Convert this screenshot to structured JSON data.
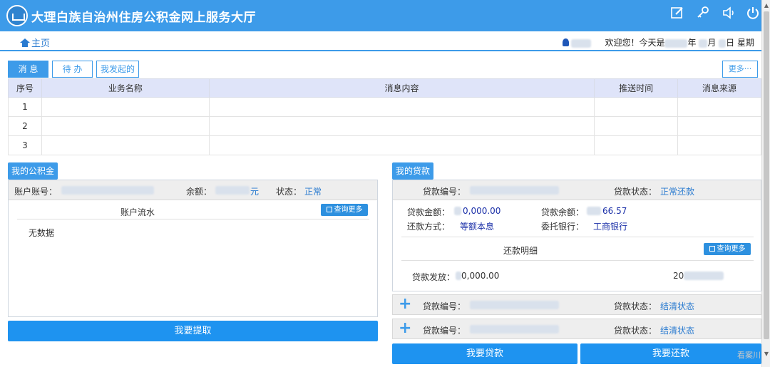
{
  "header": {
    "title": "大理白族自治州住房公积金网上服务大厅",
    "icons": [
      "edit-icon",
      "key-icon",
      "speaker-icon",
      "power-icon"
    ]
  },
  "nav": {
    "home": "主页",
    "welcome": "欢迎您！今天是",
    "date_year_suffix": "年",
    "date_month_suffix": "月",
    "date_day_suffix": "日 星期"
  },
  "tabs": [
    {
      "label": "消 息",
      "active": true
    },
    {
      "label": "待 办",
      "active": false
    },
    {
      "label": "我发起的",
      "active": false
    }
  ],
  "more_label": "更多···",
  "messages": {
    "columns": [
      "序号",
      "业务名称",
      "消息内容",
      "推送时间",
      "消息来源"
    ],
    "rows": [
      {
        "index": "1",
        "business": "",
        "content": "",
        "time": "",
        "source": ""
      },
      {
        "index": "2",
        "business": "",
        "content": "",
        "time": "",
        "source": ""
      },
      {
        "index": "3",
        "business": "",
        "content": "",
        "time": "",
        "source": ""
      }
    ]
  },
  "fund": {
    "section_title": "我的公积金",
    "account_label": "账户账号：",
    "balance_label": "余额：",
    "balance_unit": "元",
    "status_label": "状态：",
    "status_value": "正常",
    "flow_title": "账户流水",
    "query_more": "查询更多",
    "no_data": "无数据",
    "withdraw_button": "我要提取"
  },
  "loan": {
    "section_title": "我的贷款",
    "loan_no_label": "贷款编号：",
    "loan_status_label": "贷款状态：",
    "loan_status_value": "正常还款",
    "amount_label": "贷款金额：",
    "amount_value": "0,000.00",
    "remaining_label": "贷款余额：",
    "remaining_value": "66.57",
    "repay_method_label": "还款方式：",
    "repay_method_value": "等额本息",
    "bank_label": "委托银行：",
    "bank_value": "工商银行",
    "repay_detail_title": "还款明细",
    "query_more": "查询更多",
    "issue_label": "贷款发放：",
    "issue_value": "0,000.00",
    "issue_date": "20",
    "other_loans": [
      {
        "loan_no_label": "贷款编号：",
        "status_label": "贷款状态：",
        "status_value": "结清状态"
      },
      {
        "loan_no_label": "贷款编号：",
        "status_label": "贷款状态：",
        "status_value": "结清状态"
      }
    ],
    "apply_button": "我要贷款",
    "repay_button": "我要还款"
  },
  "watermark": "看案川"
}
